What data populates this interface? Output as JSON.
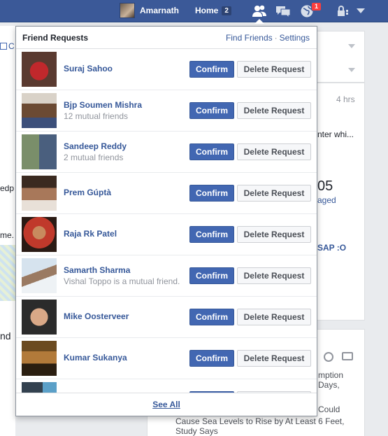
{
  "topbar": {
    "user_name": "Amarnath",
    "home_label": "Home",
    "home_count": "2",
    "notification_count": "1"
  },
  "background": {
    "left_fragments": [
      "C",
      "edp",
      "me.",
      "nd"
    ],
    "right_fragments": {
      "time": "4 hrs",
      "snippet1": "nter whi...",
      "big_number": "05",
      "engaged": "aged",
      "asap": "SAP :O",
      "news1": "mption",
      "news2": "Days,",
      "news3": "Could",
      "news4": "Cause Sea Levels to Rise by At Least 6 Feet,",
      "news5": "Study Says"
    }
  },
  "flyout": {
    "title": "Friend Requests",
    "find_friends": "Find Friends",
    "separator": "·",
    "settings": "Settings",
    "see_all": "See All",
    "confirm_label": "Confirm",
    "delete_label": "Delete Request",
    "requests": [
      {
        "name": "Suraj Sahoo",
        "sub": ""
      },
      {
        "name": "Bjp Soumen Mishra",
        "sub": "12 mutual friends"
      },
      {
        "name": "Sandeep Reddy",
        "sub": "2 mutual friends"
      },
      {
        "name": "Prem Gúptà",
        "sub": ""
      },
      {
        "name": "Raja Rk Patel",
        "sub": ""
      },
      {
        "name": "Samarth Sharma",
        "sub": "Vishal Toppo is a mutual friend."
      },
      {
        "name": "Mike Oosterveer",
        "sub": ""
      },
      {
        "name": "Kumar Sukanya",
        "sub": ""
      },
      {
        "name": "",
        "sub": ""
      }
    ]
  }
}
